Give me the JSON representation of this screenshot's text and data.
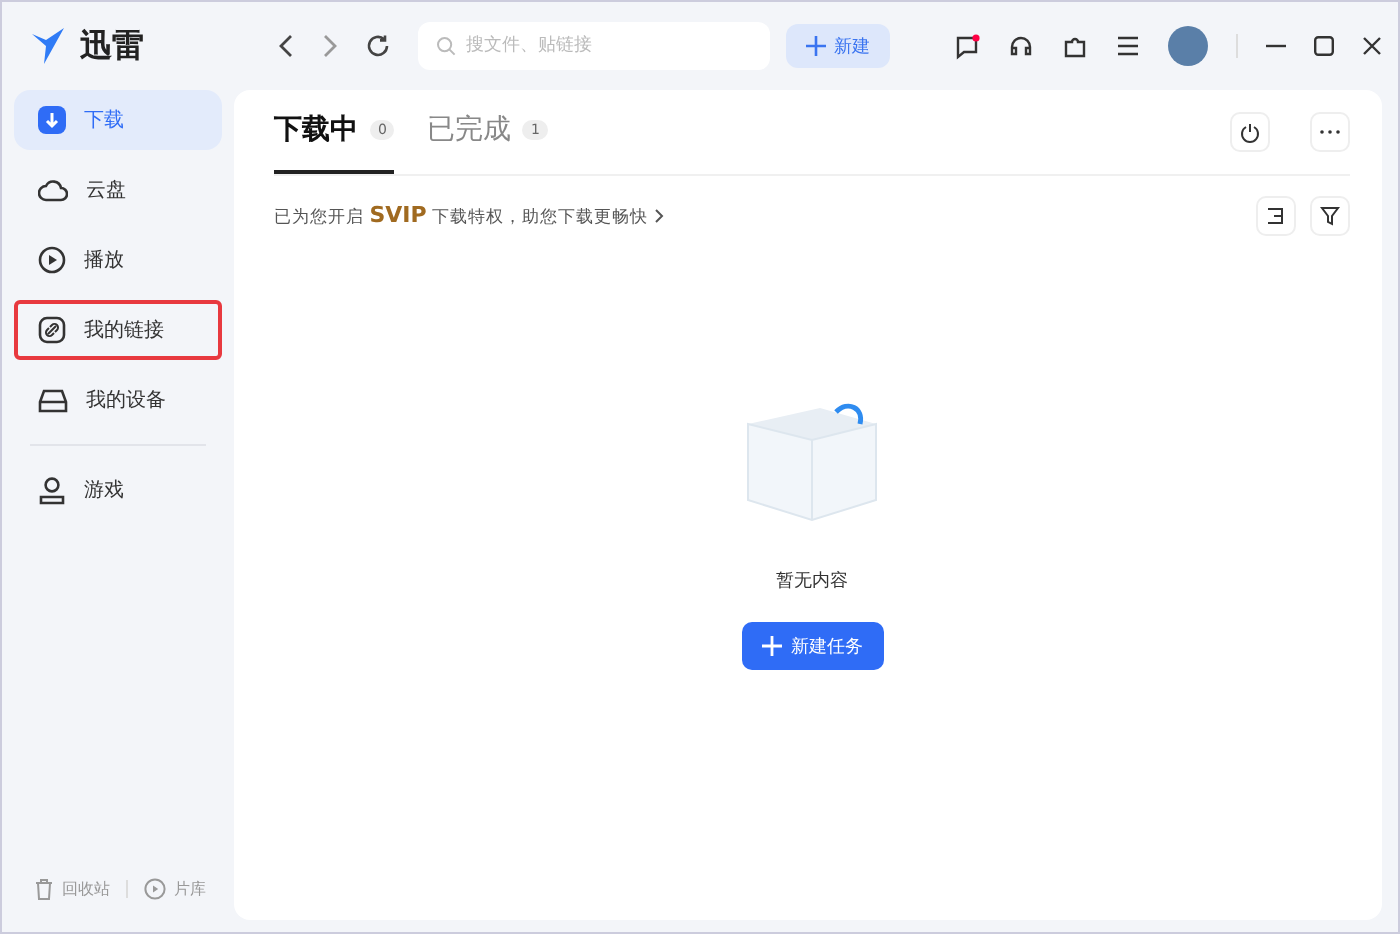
{
  "app": {
    "name": "迅雷"
  },
  "toolbar": {
    "search": {
      "placeholder": "搜文件、贴链接"
    },
    "new_button": "新建"
  },
  "sidebar": {
    "items": [
      {
        "label": "下载",
        "kind": "download",
        "selected": true,
        "highlighted": false
      },
      {
        "label": "云盘",
        "kind": "cloud",
        "selected": false,
        "highlighted": false
      },
      {
        "label": "播放",
        "kind": "play",
        "selected": false,
        "highlighted": false
      },
      {
        "label": "我的链接",
        "kind": "link",
        "selected": false,
        "highlighted": true
      },
      {
        "label": "我的设备",
        "kind": "device",
        "selected": false,
        "highlighted": false
      },
      {
        "label": "游戏",
        "kind": "game",
        "selected": false,
        "highlighted": false
      }
    ],
    "footer": [
      {
        "label": "回收站",
        "kind": "trash"
      },
      {
        "label": "片库",
        "kind": "library"
      }
    ]
  },
  "tabs": [
    {
      "label": "下载中",
      "count": "0",
      "selected": true
    },
    {
      "label": "已完成",
      "count": "1",
      "selected": false
    }
  ],
  "banner": "已为您开启 **SVIP** 下载特权，助您下载更畅快",
  "empty_state": {
    "message": "暂无内容",
    "button": "新建任务"
  }
}
